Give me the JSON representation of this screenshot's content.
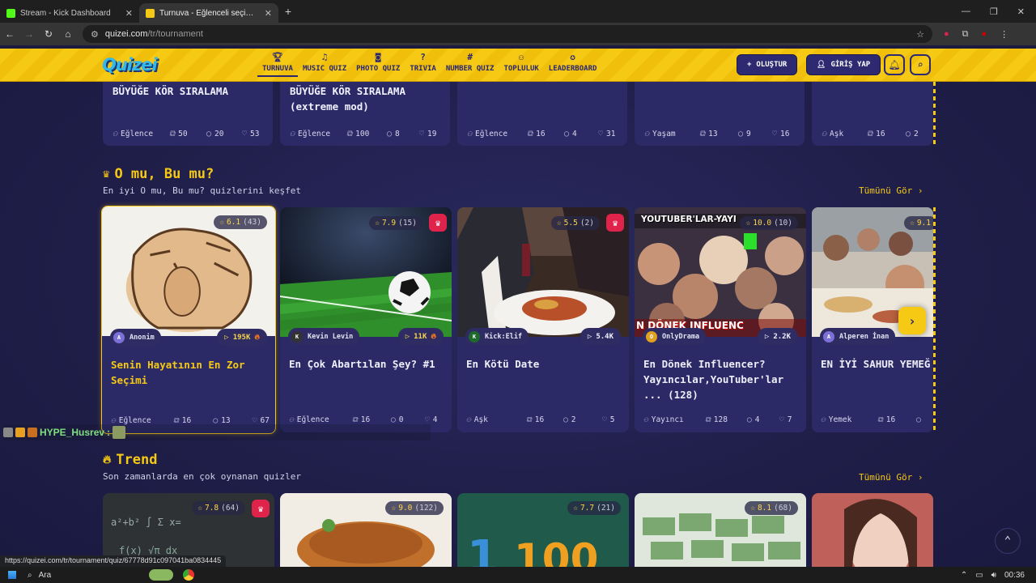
{
  "browser": {
    "tabs": [
      {
        "title": "Stream - Kick Dashboard",
        "icon": "kick-icon",
        "color": "#53fc18",
        "active": false
      },
      {
        "title": "Turnuva - Eğlenceli seçimler ya",
        "icon": "quizei-icon",
        "color": "#f6c914",
        "active": true
      }
    ],
    "url_host": "quizei.com",
    "url_path": "/tr/tournament",
    "status_url": "https://quizei.com/tr/tournament/quiz/67778d91c097041ba0834445"
  },
  "header": {
    "logo": "Quizei",
    "nav": [
      {
        "label": "TURNUVA",
        "icon": "trophy-icon",
        "active": true
      },
      {
        "label": "MUSIC QUIZ",
        "icon": "music-note-icon"
      },
      {
        "label": "PHOTO QUIZ",
        "icon": "camera-icon"
      },
      {
        "label": "TRIVIA",
        "icon": "question-bubble-icon"
      },
      {
        "label": "NUMBER QUIZ",
        "icon": "hash-icon"
      },
      {
        "label": "TOPLULUK",
        "icon": "community-icon"
      },
      {
        "label": "LEADERBOARD",
        "icon": "medal-icon"
      }
    ],
    "create_label": "OLUŞTUR",
    "login_label": "GİRİŞ YAP"
  },
  "top_cards": [
    {
      "title": "BÜYÜĞE KÖR SIRALAMA",
      "category": "Eğlence",
      "questions": "50",
      "comments": "20",
      "likes": "53"
    },
    {
      "title": "BÜYÜĞE KÖR SIRALAMA (extreme mod)",
      "category": "Eğlence",
      "questions": "100",
      "comments": "8",
      "likes": "19"
    },
    {
      "title": "",
      "category": "Eğlence",
      "questions": "16",
      "comments": "4",
      "likes": "31"
    },
    {
      "title": "",
      "category": "Yaşam",
      "questions": "13",
      "comments": "9",
      "likes": "16"
    },
    {
      "title": "",
      "category": "Aşk",
      "questions": "16",
      "comments": "2",
      "likes": ""
    }
  ],
  "section_omu": {
    "title": "O mu, Bu mu?",
    "subtitle": "En iyi O mu, Bu mu? quizlerini keşfet",
    "see_all": "Tümünü Gör ›",
    "cards": [
      {
        "title": "Senin Hayatının En Zor Seçimi",
        "rating": "6.1",
        "votes": "(43)",
        "author": "Anonim",
        "plays": "195K",
        "hot": true,
        "category": "Eğlence",
        "questions": "16",
        "comments": "13",
        "likes": "67"
      },
      {
        "title": "En Çok Abartılan Şey? #1",
        "rating": "7.9",
        "votes": "(15)",
        "author": "Kevin Levin",
        "plays": "11K",
        "hot": true,
        "category": "Eğlence",
        "questions": "16",
        "comments": "0",
        "likes": "4"
      },
      {
        "title": "En Kötü Date",
        "rating": "5.5",
        "votes": "(2)",
        "author": "Kick:Elif",
        "plays": "5.4K",
        "hot": false,
        "category": "Aşk",
        "questions": "16",
        "comments": "2",
        "likes": "5"
      },
      {
        "title": "En Dönek Influencer? Yayıncılar,YouTuber'lar ... (128)",
        "rating": "10.0",
        "votes": "(10)",
        "author": "OnlyDrama",
        "plays": "2.2K",
        "hot": false,
        "category": "Yayıncı",
        "questions": "128",
        "comments": "4",
        "likes": "7",
        "image_text": "YOUTUBER'LAR-YAYI",
        "image_text2": "N DÖNEK INFLUENC"
      },
      {
        "title": "EN İYİ SAHUR YEMEĞ",
        "rating": "9.1",
        "votes": "",
        "author": "Alperen İnan",
        "plays": "",
        "hot": false,
        "category": "Yemek",
        "questions": "16",
        "comments": "",
        "likes": ""
      }
    ]
  },
  "section_trend": {
    "title": "Trend",
    "subtitle": "Son zamanlarda en çok oynanan quizler",
    "see_all": "Tümünü Gör ›",
    "cards": [
      {
        "rating": "7.8",
        "votes": "(64)"
      },
      {
        "rating": "9.0",
        "votes": "(122)"
      },
      {
        "rating": "7.7",
        "votes": "(21)",
        "image_text": "100"
      },
      {
        "rating": "8.1",
        "votes": "(68)"
      }
    ]
  },
  "overlay_chat": {
    "user": "HYPE_Husrev",
    "suffix": ":"
  },
  "taskbar": {
    "search": "Ara",
    "time": "00:36"
  },
  "colors": {
    "accent": "#f6c914",
    "card": "#2b2a66",
    "bg": "#1f1e48",
    "crown": "#e0234a"
  }
}
